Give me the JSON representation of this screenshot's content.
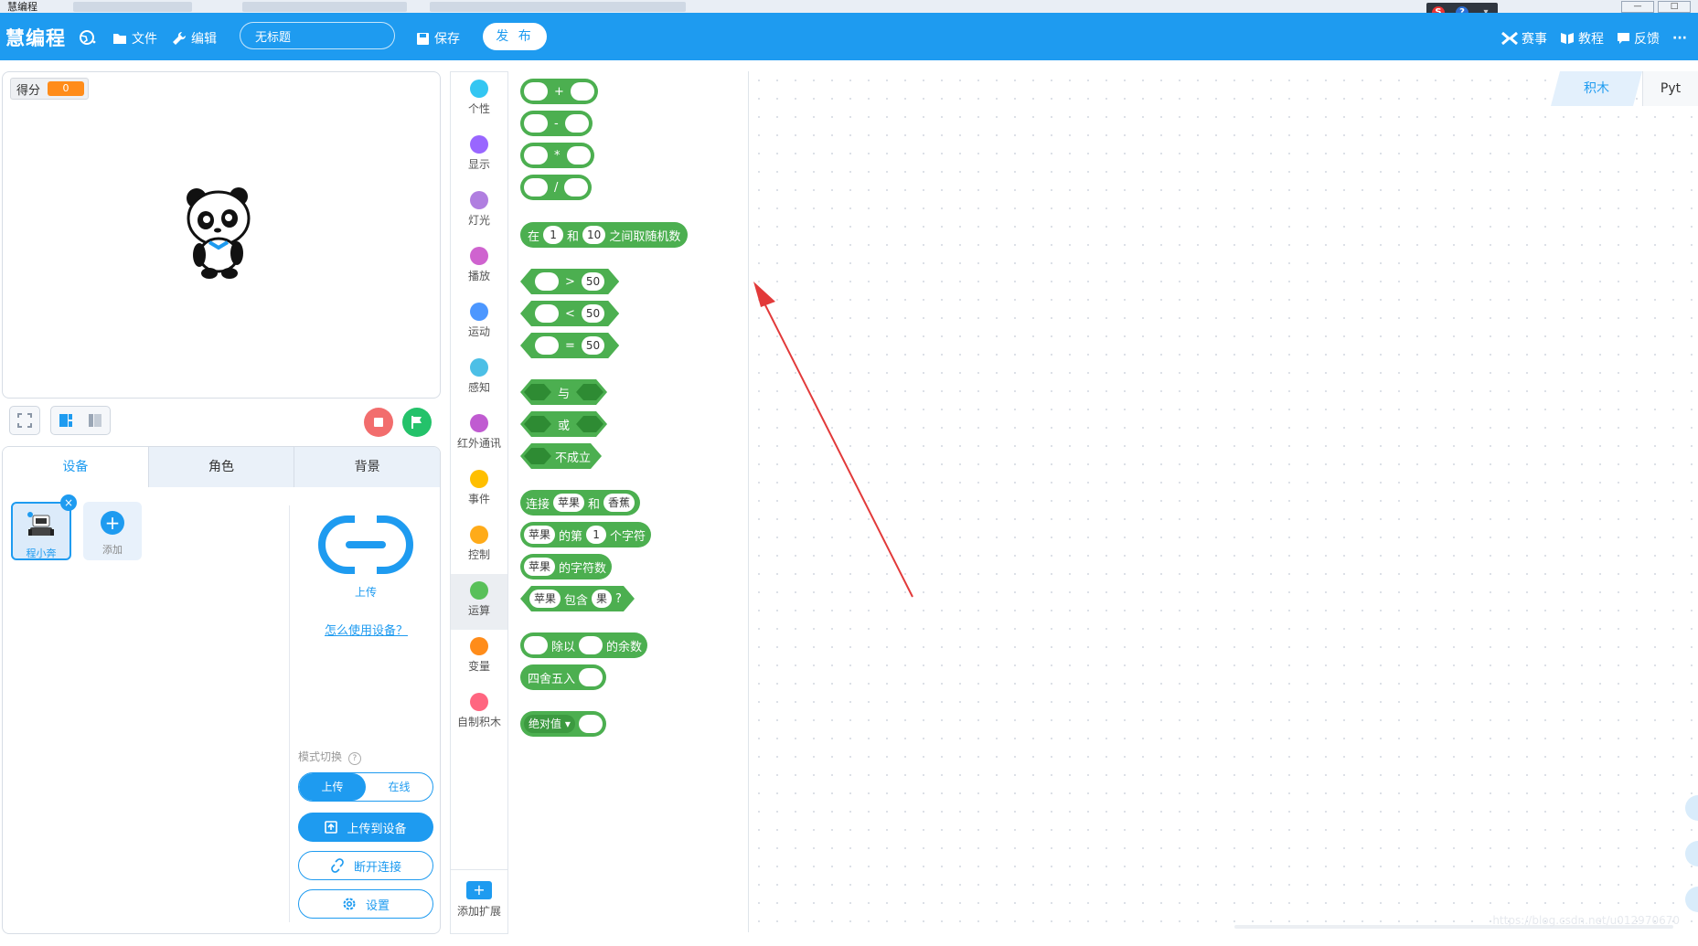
{
  "window": {
    "title": "慧编程"
  },
  "topbar": {
    "brand": "慧编程",
    "file": "文件",
    "edit": "编辑",
    "project_title": "无标题",
    "save": "保存",
    "publish": "发 布",
    "contest": "赛事",
    "tutorial": "教程",
    "feedback": "反馈",
    "more": "···"
  },
  "stage": {
    "score_label": "得分",
    "score_value": "0"
  },
  "device_panel": {
    "tabs": [
      "设备",
      "角色",
      "背景"
    ],
    "device_name": "程小奔",
    "add_label": "添加",
    "upload_label": "上传",
    "howto_link": "怎么使用设备？",
    "mode_label": "模式切换",
    "mode_upload": "上传",
    "mode_online": "在线",
    "upload_to_device": "上传到设备",
    "disconnect": "断开连接",
    "settings": "设置"
  },
  "categories": [
    {
      "label": "个性",
      "color": "#33c6f2"
    },
    {
      "label": "显示",
      "color": "#9966ff"
    },
    {
      "label": "灯光",
      "color": "#b07ee0"
    },
    {
      "label": "播放",
      "color": "#cf63cf"
    },
    {
      "label": "运动",
      "color": "#4c97ff"
    },
    {
      "label": "感知",
      "color": "#4cbfe6"
    },
    {
      "label": "红外通讯",
      "color": "#c05bd1"
    },
    {
      "label": "事件",
      "color": "#ffbf00"
    },
    {
      "label": "控制",
      "color": "#ffab19"
    },
    {
      "label": "运算",
      "color": "#59c059"
    },
    {
      "label": "变量",
      "color": "#ff8c1a"
    },
    {
      "label": "自制积木",
      "color": "#ff6680"
    }
  ],
  "add_extension": "添加扩展",
  "blocks": {
    "plus": "+",
    "minus": "-",
    "times": "*",
    "divide": "/",
    "random_pre": "在",
    "random_a": "1",
    "random_and": "和",
    "random_b": "10",
    "random_post": "之间取随机数",
    "gt": ">",
    "lt": "<",
    "eq": "=",
    "cmp_value": "50",
    "and": "与",
    "or": "或",
    "not": "不成立",
    "join": "连接",
    "apple": "苹果",
    "banana": "香蕉",
    "letter_of": "的第",
    "letter_idx": "1",
    "letter_post": "个字符",
    "length_of": "的字符数",
    "contains": "包含",
    "contains_val": "果",
    "q": "?",
    "mod_of": "除以",
    "mod_post": "的余数",
    "round": "四舍五入",
    "abs": "绝对值 ▾"
  },
  "workspace": {
    "tab_blocks": "积木",
    "tab_python": "Pyt",
    "watermark": "https://blog.csdn.net/u012970670"
  },
  "colors": {
    "brand": "#1e9bf0",
    "operator_block": "#4caf50",
    "stop": "#f26d6d",
    "go": "#24c26a",
    "score": "#ff8c1a"
  }
}
